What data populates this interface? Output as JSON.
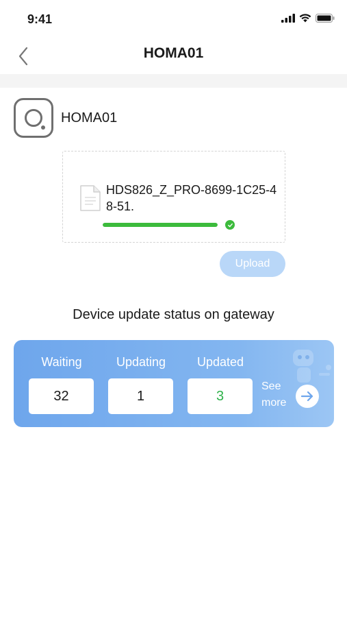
{
  "status_bar": {
    "time": "9:41"
  },
  "nav": {
    "title": "HOMA01",
    "back_icon": "chevron-left-icon"
  },
  "device": {
    "name": "HOMA01",
    "icon": "device-sensor-icon"
  },
  "upload": {
    "file_icon": "document-icon",
    "file_name": "HDS826_Z_PRO-8699-1C25-48-51.",
    "progress": 1.0,
    "progress_color": "#3cbb3c",
    "status_icon": "check-circle-icon",
    "button_label": "Upload"
  },
  "update_status": {
    "title": "Device update status on gateway",
    "waiting_label": "Waiting",
    "waiting_value": "32",
    "updating_label": "Updating",
    "updating_value": "1",
    "updated_label": "Updated",
    "updated_value": "3",
    "see_more_label": "See more",
    "arrow_icon": "arrow-right-circle-icon",
    "accent_color": "#6ea6ec"
  }
}
